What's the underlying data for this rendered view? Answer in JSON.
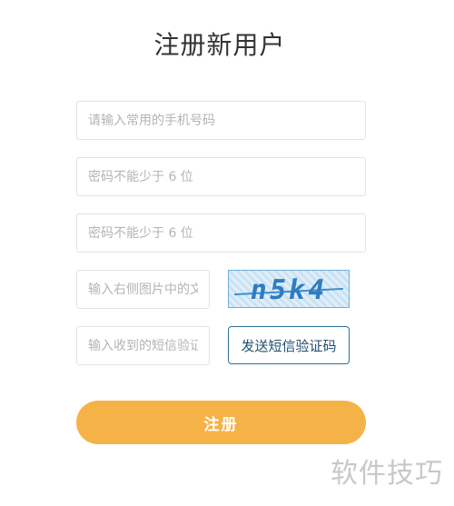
{
  "page": {
    "title": "注册新用户"
  },
  "form": {
    "phone_placeholder": "请输入常用的手机号码",
    "password_placeholder": "密码不能少于 6 位",
    "confirm_password_placeholder": "密码不能少于 6 位",
    "captcha_placeholder": "输入右侧图片中的文",
    "captcha_image_text": "n5k4",
    "sms_placeholder": "输入收到的短信验证",
    "send_sms_label": "发送短信验证码",
    "submit_label": "注册"
  },
  "watermark": {
    "text": "软件技巧"
  },
  "colors": {
    "accent": "#f5b347",
    "send_button_border": "#2f6f95",
    "captcha_text": "#2f7cbf"
  }
}
